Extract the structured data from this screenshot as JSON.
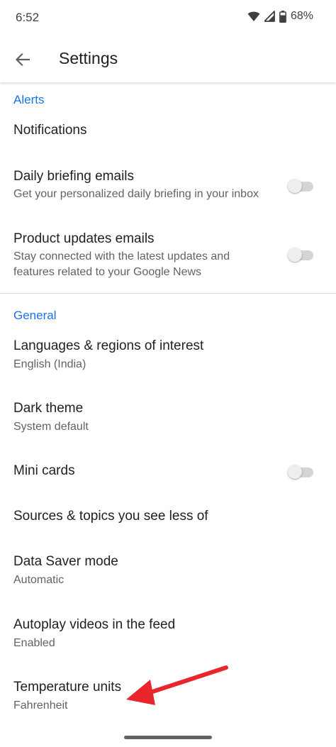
{
  "status_bar": {
    "time": "6:52",
    "battery": "68%"
  },
  "app_bar": {
    "title": "Settings"
  },
  "sections": {
    "alerts": {
      "header": "Alerts",
      "notifications": {
        "title": "Notifications"
      },
      "daily_briefing": {
        "title": "Daily briefing emails",
        "subtitle": "Get your personalized daily briefing in your inbox",
        "enabled": false
      },
      "product_updates": {
        "title": "Product updates emails",
        "subtitle": "Stay connected with the latest updates and features related to your Google News",
        "enabled": false
      }
    },
    "general": {
      "header": "General",
      "languages": {
        "title": "Languages & regions of interest",
        "subtitle": "English (India)"
      },
      "dark_theme": {
        "title": "Dark theme",
        "subtitle": "System default"
      },
      "mini_cards": {
        "title": "Mini cards",
        "enabled": false
      },
      "sources_topics": {
        "title": "Sources & topics you see less of"
      },
      "data_saver": {
        "title": "Data Saver mode",
        "subtitle": "Automatic"
      },
      "autoplay": {
        "title": "Autoplay videos in the feed",
        "subtitle": "Enabled"
      },
      "temperature": {
        "title": "Temperature units",
        "subtitle": "Fahrenheit"
      }
    }
  },
  "colors": {
    "accent": "#1a73e8",
    "annotation_arrow": "#e8262b",
    "toggle_track_off": "#d5d5d5",
    "toggle_thumb_off": "#eeeeee"
  },
  "icons": {
    "back": "back-arrow-icon",
    "wifi": "wifi-icon",
    "signal": "cell-signal-icon",
    "battery": "battery-icon"
  }
}
